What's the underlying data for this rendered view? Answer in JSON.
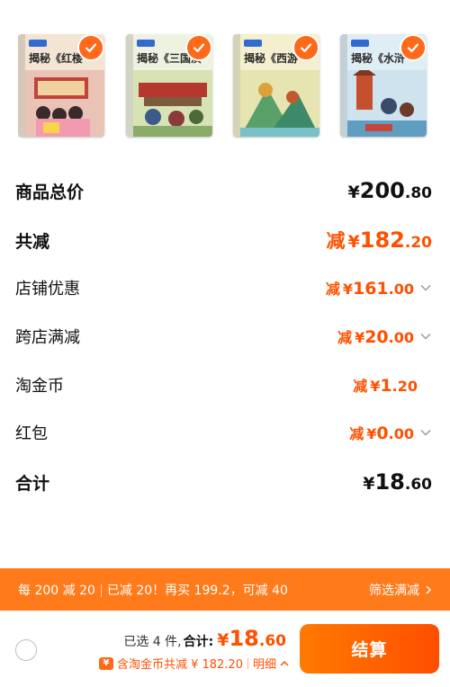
{
  "products": [
    {
      "title": "揭秘《红楼",
      "cover_color": "#f4e4d4",
      "scene_color": "#e9a7a0",
      "selected": true
    },
    {
      "title": "揭秘《三国演",
      "cover_color": "#eef2e0",
      "scene_color": "#b4c994",
      "selected": true
    },
    {
      "title": "揭秘《西游",
      "cover_color": "#f3efcf",
      "scene_color": "#c7d18a",
      "selected": true
    },
    {
      "title": "揭秘《水浒",
      "cover_color": "#dfeef5",
      "scene_color": "#9cc4d8",
      "selected": true
    }
  ],
  "summary": {
    "goods_total": {
      "label": "商品总价",
      "currency": "¥",
      "int": "200",
      "dec": ".80"
    },
    "total_reduction": {
      "label": "共减",
      "prefix": "减",
      "currency": "¥",
      "int": "182",
      "dec": ".20"
    },
    "shop_discount": {
      "label": "店铺优惠",
      "prefix": "减",
      "currency": "¥",
      "int": "161",
      "dec": ".00"
    },
    "cross_shop": {
      "label": "跨店满减",
      "prefix": "减",
      "currency": "¥",
      "int": "20",
      "dec": ".00"
    },
    "taojinbi": {
      "label": "淘金币",
      "prefix": "减",
      "currency": "¥",
      "int": "1",
      "dec": ".20"
    },
    "red_packet": {
      "label": "红包",
      "prefix": "减",
      "currency": "¥",
      "int": "0",
      "dec": ".00"
    },
    "grand_total": {
      "label": "合计",
      "currency": "¥",
      "int": "18",
      "dec": ".60"
    }
  },
  "promo": {
    "rule": "每 200 减 20",
    "status": "已减 20！再买 199.2，可减 40",
    "action": "筛选满减"
  },
  "bottom": {
    "selected_count": "已选 4 件,",
    "total_label": "合计:",
    "total_currency": "¥",
    "total_int": "18",
    "total_dec": ".60",
    "coin_icon": "¥",
    "coin_text": "含淘金币共减 ¥ 182.20",
    "detail_label": "明细",
    "checkout_label": "结算"
  },
  "colors": {
    "accent": "#ff5000",
    "promo_bar": "#ff7a1a",
    "check": "#ff6a1a"
  }
}
